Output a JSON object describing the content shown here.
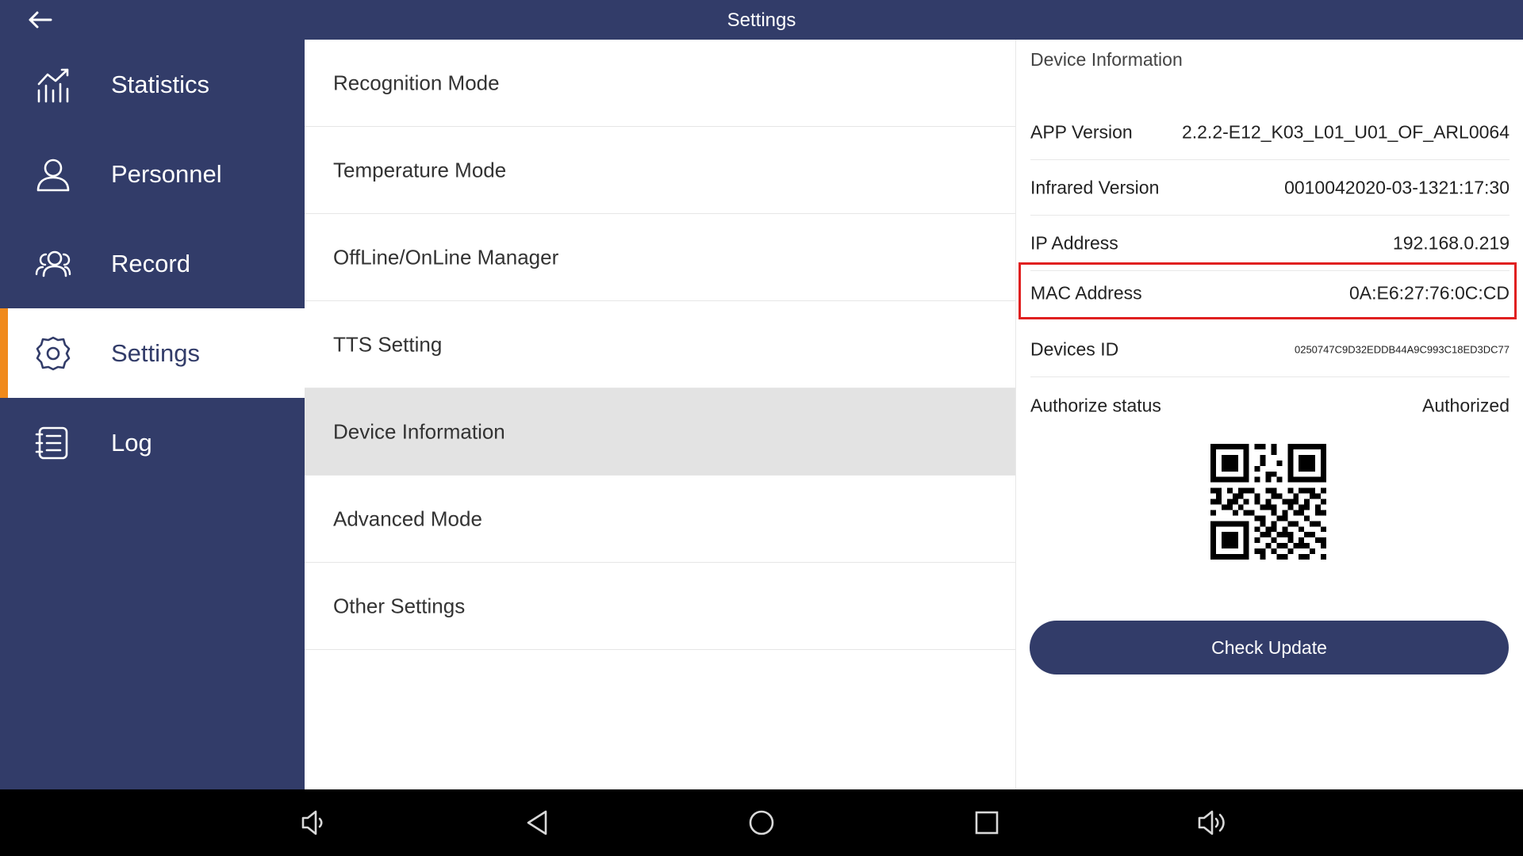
{
  "header": {
    "title": "Settings"
  },
  "sidebar": {
    "items": [
      {
        "label": "Statistics",
        "icon": "statistics-icon"
      },
      {
        "label": "Personnel",
        "icon": "person-icon"
      },
      {
        "label": "Record",
        "icon": "people-icon"
      },
      {
        "label": "Settings",
        "icon": "gear-icon"
      },
      {
        "label": "Log",
        "icon": "log-icon"
      }
    ],
    "active": "Settings"
  },
  "menu": {
    "items": [
      {
        "label": "Recognition Mode"
      },
      {
        "label": "Temperature Mode"
      },
      {
        "label": "OffLine/OnLine Manager"
      },
      {
        "label": "TTS Setting"
      },
      {
        "label": "Device Information"
      },
      {
        "label": "Advanced Mode"
      },
      {
        "label": "Other Settings"
      }
    ],
    "selected": "Device Information"
  },
  "device_info": {
    "title": "Device Information",
    "rows": [
      {
        "key": "APP Version",
        "value": "2.2.2-E12_K03_L01_U01_OF_ARL0064"
      },
      {
        "key": "Infrared Version",
        "value": "0010042020-03-1321:17:30"
      },
      {
        "key": "IP Address",
        "value": "192.168.0.219"
      },
      {
        "key": "MAC Address",
        "value": "0A:E6:27:76:0C:CD"
      },
      {
        "key": "Devices ID",
        "value": "0250747C9D32EDDB44A9C993C18ED3DC77"
      },
      {
        "key": "Authorize status",
        "value": "Authorized"
      }
    ],
    "qr_icon": "qr-code-icon",
    "check_update_label": "Check Update"
  },
  "colors": {
    "primary": "#323c69",
    "accent": "#f08a1c",
    "highlight": "#e02020",
    "selected_row": "#e3e3e3"
  },
  "system_nav": {
    "icons": [
      "volume-down-icon",
      "back-icon",
      "home-icon",
      "recents-icon",
      "volume-up-icon"
    ]
  }
}
